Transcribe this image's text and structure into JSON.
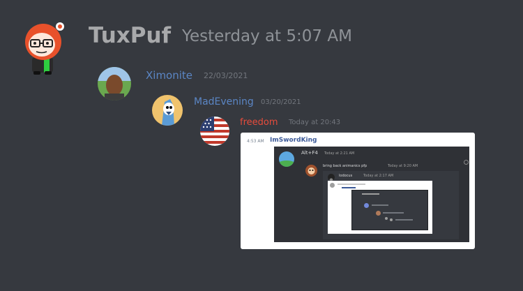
{
  "messages": [
    {
      "username": "TuxPuf",
      "timestamp": "Yesterday at 5:07 AM",
      "name_color": "#a8a9ab"
    },
    {
      "username": "Ximonite",
      "timestamp": "22/03/2021",
      "name_color": "#5b86c5"
    },
    {
      "username": "MadEvening",
      "timestamp": "03/20/2021",
      "name_color": "#5b86c5"
    },
    {
      "username": "freedom",
      "timestamp": "Today at 20:43",
      "name_color": "#e74c3c"
    }
  ],
  "embed": {
    "time": "4:53 AM",
    "username": "ImSwordKing",
    "nested": {
      "username": "Alt+F4",
      "timestamp": "Today at 2:21 AM",
      "message": "bring back animanics pfp",
      "message_time": "Today at 9:20 AM",
      "inner_username": "lodocus",
      "inner_timestamp": "Today at 2:17 AM"
    }
  }
}
